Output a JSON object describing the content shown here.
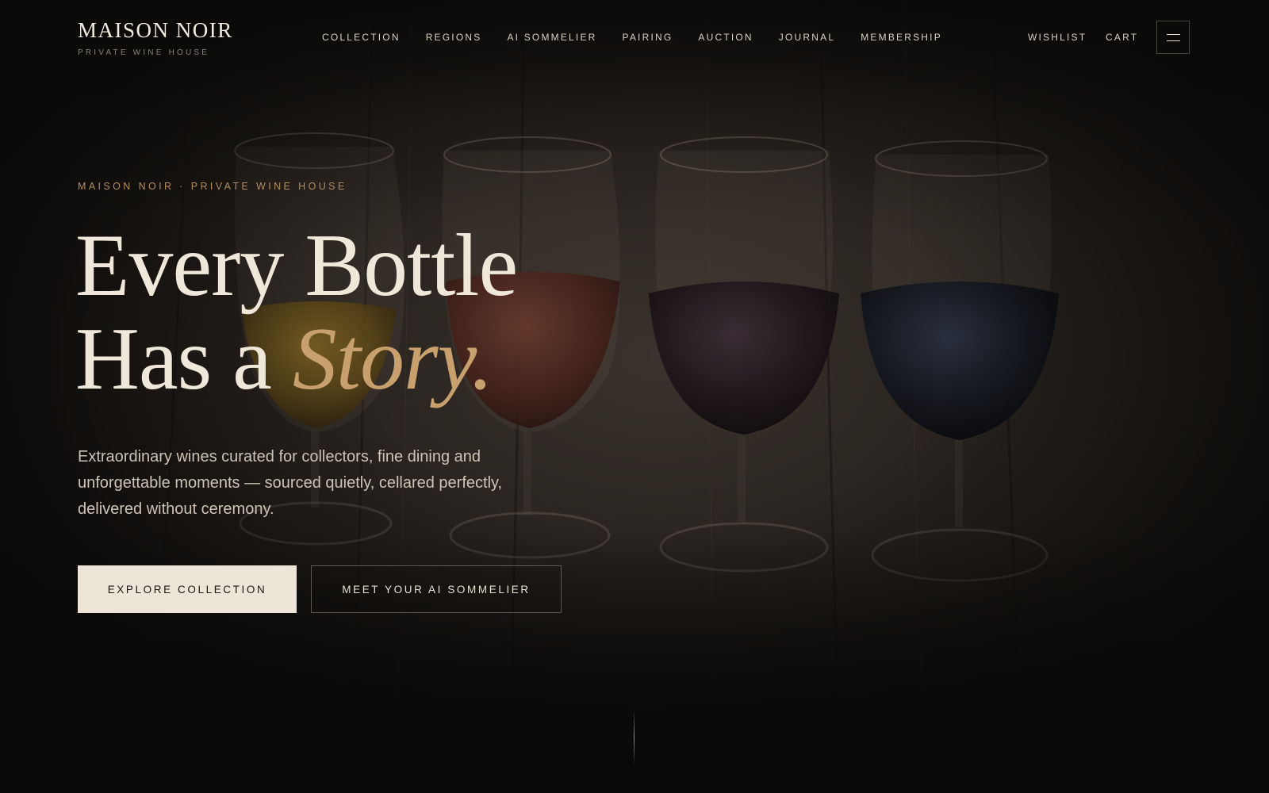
{
  "brand": {
    "name": "MAISON NOIR",
    "tagline": "PRIVATE WINE HOUSE"
  },
  "nav": {
    "items": [
      {
        "label": "COLLECTION"
      },
      {
        "label": "REGIONS"
      },
      {
        "label": "AI SOMMELIER"
      },
      {
        "label": "PAIRING"
      },
      {
        "label": "AUCTION"
      },
      {
        "label": "JOURNAL"
      },
      {
        "label": "MEMBERSHIP"
      }
    ],
    "wishlist": "WISHLIST",
    "cart": "CART",
    "menu_icon": "hamburger-menu-icon"
  },
  "hero": {
    "eyebrow": "MAISON NOIR · PRIVATE WINE HOUSE",
    "headline_line1": "Every Bottle",
    "headline_line2_prefix": "Has a ",
    "headline_accent": "Story",
    "headline_suffix": ".",
    "lede": "Extraordinary wines curated for collectors, fine dining and unforgettable moments — sourced quietly, cellared perfectly, delivered without ceremony.",
    "primary_cta": "EXPLORE COLLECTION",
    "secondary_cta": "MEET YOUR AI SOMMELIER",
    "background_image": "four-wine-glasses-on-wooden-barrel"
  },
  "colors": {
    "background": "#0d0b09",
    "cream": "#efe7da",
    "gold_accent": "#c7a06e",
    "eyebrow_gold": "#b28d5d",
    "button_cream": "#ede5d8"
  }
}
